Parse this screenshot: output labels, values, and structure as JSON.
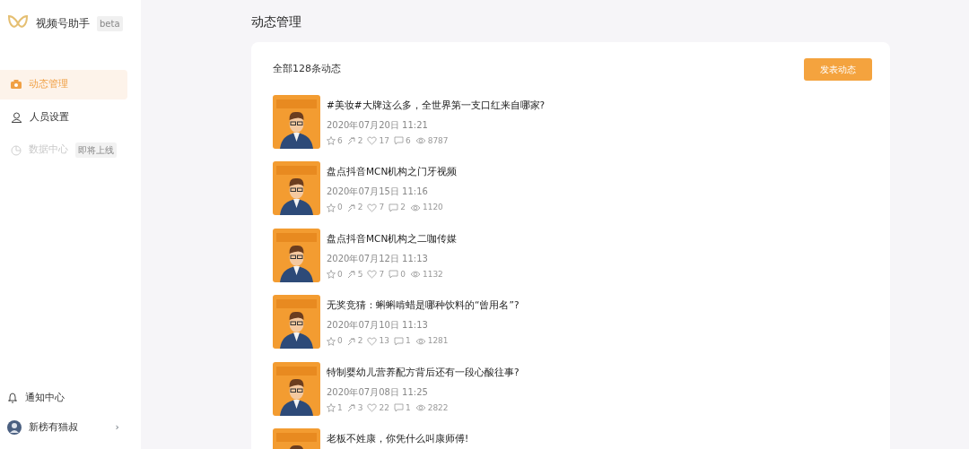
{
  "app": {
    "name": "视频号助手",
    "badge": "beta"
  },
  "nav": [
    {
      "label": "动态管理",
      "selected": true,
      "disabled": false
    },
    {
      "label": "人员设置",
      "selected": false,
      "disabled": false
    },
    {
      "label": "数据中心",
      "selected": false,
      "disabled": true,
      "badge": "即将上线"
    }
  ],
  "footer": {
    "notifications": "通知中心",
    "user": "新榜有猫叔",
    "chevron": "›"
  },
  "page_title": "动态管理",
  "summary": "全部128条动态",
  "publish_button": "发表动态",
  "posts": [
    {
      "title": "#美妆#大牌这么多，全世界第一支口红来自哪家?",
      "date": "2020年07月20日 11:21",
      "stats": [
        "6",
        "2",
        "17",
        "6",
        "8787"
      ]
    },
    {
      "title": "盘点抖音MCN机构之门牙视频",
      "date": "2020年07月15日 11:16",
      "stats": [
        "0",
        "2",
        "7",
        "2",
        "1120"
      ]
    },
    {
      "title": "盘点抖音MCN机构之二咖传媒",
      "date": "2020年07月12日 11:13",
      "stats": [
        "0",
        "5",
        "7",
        "0",
        "1132"
      ]
    },
    {
      "title": "无奖竞猜：蝌蝌啃蜡是哪种饮料的“曾用名”?",
      "date": "2020年07月10日 11:13",
      "stats": [
        "0",
        "2",
        "13",
        "1",
        "1281"
      ]
    },
    {
      "title": "特制婴幼儿营养配方背后还有一段心酸往事?",
      "date": "2020年07月08日 11:25",
      "stats": [
        "1",
        "3",
        "22",
        "1",
        "2822"
      ]
    },
    {
      "title": "老板不姓康，你凭什么叫康师傅!"
    }
  ]
}
